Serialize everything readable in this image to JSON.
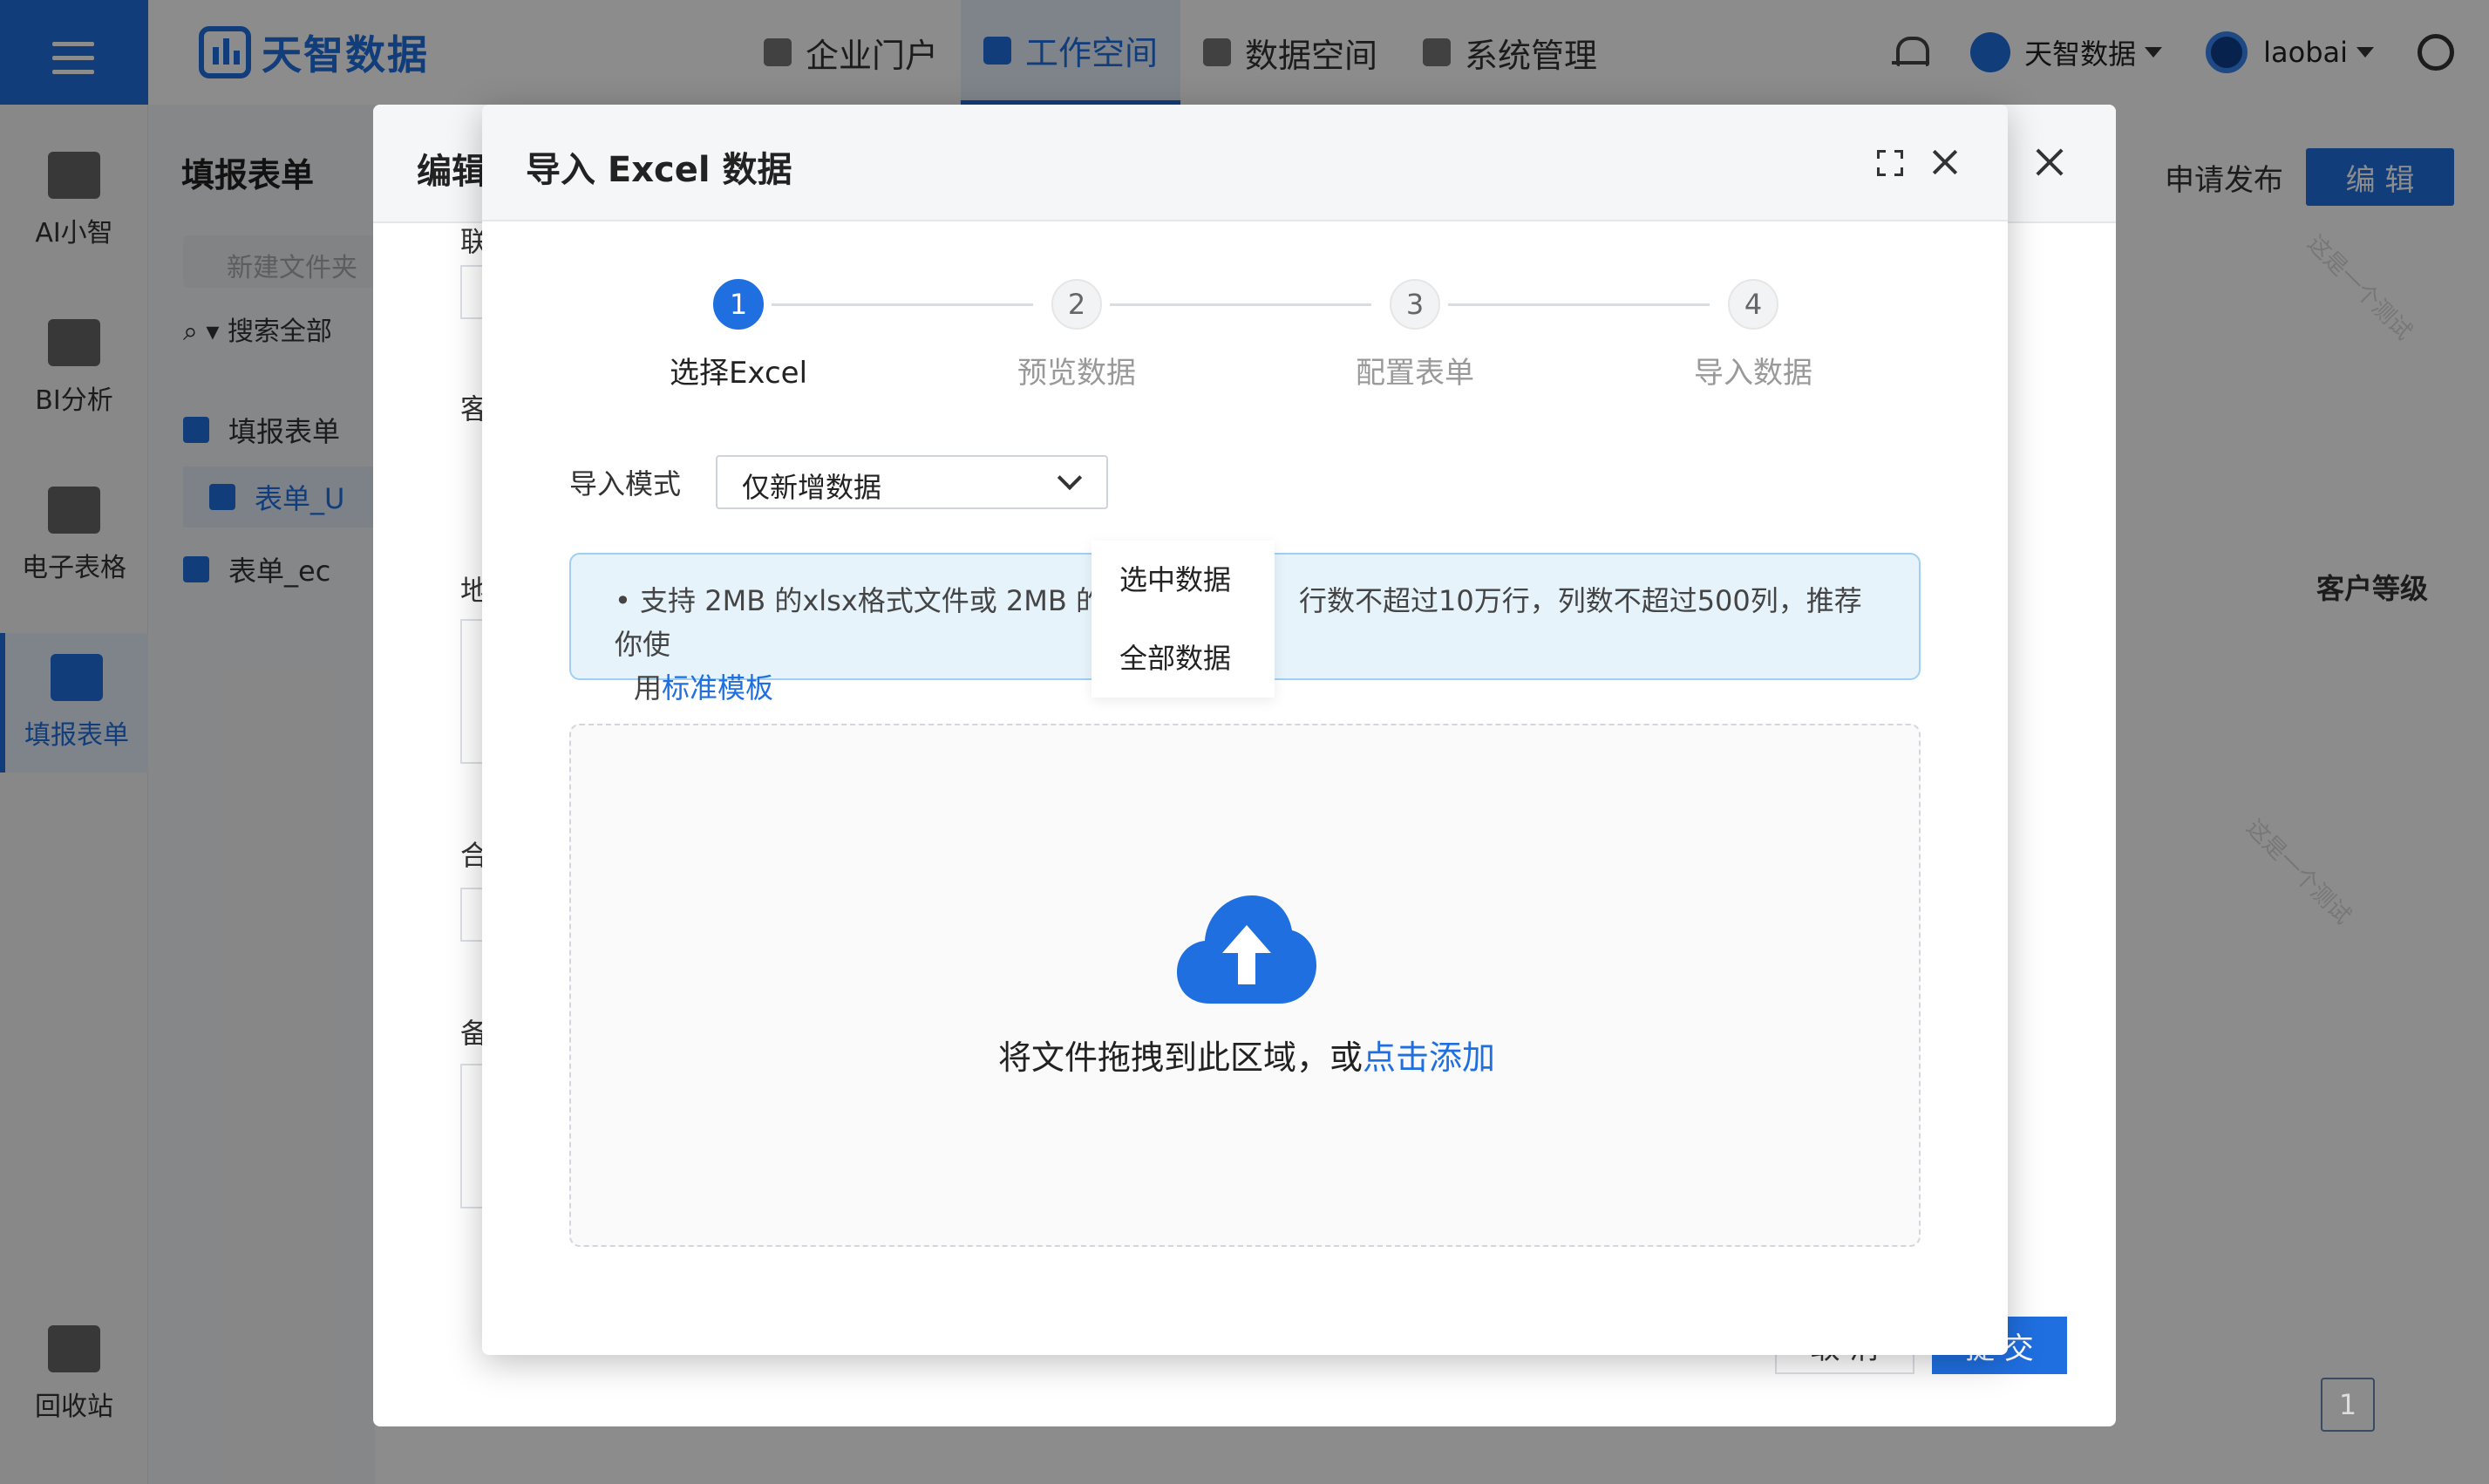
{
  "header": {
    "logo_text": "天智数据",
    "nav": [
      {
        "label": "企业门户",
        "active": false
      },
      {
        "label": "工作空间",
        "active": true
      },
      {
        "label": "数据空间",
        "active": false
      },
      {
        "label": "系统管理",
        "active": false
      }
    ],
    "org_name": "天智数据",
    "username": "laobai"
  },
  "sidebar": {
    "items": [
      {
        "label": "AI小智",
        "icon": "ai-icon",
        "active": false
      },
      {
        "label": "BI分析",
        "icon": "bi-chart-icon",
        "active": false
      },
      {
        "label": "电子表格",
        "icon": "spreadsheet-icon",
        "active": false
      },
      {
        "label": "填报表单",
        "icon": "form-icon",
        "active": true
      },
      {
        "label": "回收站",
        "icon": "trash-icon",
        "active": false
      }
    ]
  },
  "tree": {
    "title": "填报表单",
    "new_folder_placeholder": "新建文件夹",
    "search_label": "搜索全部",
    "root": "填报表单",
    "items": [
      "表单_U",
      "表单_ec"
    ]
  },
  "toolbar": {
    "publish_label": "申请发布",
    "edit_label": "编 辑",
    "column_header": "客户等级"
  },
  "drawer": {
    "title": "编辑",
    "field_labels": [
      "联",
      "客",
      "地",
      "合",
      "备"
    ],
    "cancel_label": "取 消",
    "submit_label": "提 交"
  },
  "modal": {
    "title": "导入 Excel 数据",
    "steps": [
      {
        "num": "1",
        "label": "选择Excel",
        "active": true
      },
      {
        "num": "2",
        "label": "预览数据",
        "active": false
      },
      {
        "num": "3",
        "label": "配置表单",
        "active": false
      },
      {
        "num": "4",
        "label": "导入数据",
        "active": false
      }
    ],
    "mode_label": "导入模式",
    "mode_value": "仅新增数据",
    "mode_options": [
      "选中数据",
      "全部数据"
    ],
    "info_bullet": "•",
    "info_line1_a": "支持 2MB 的xlsx格式文件或 2MB 的x",
    "info_line1_b": "行数不超过10万行，列数不超过500列，推荐你使",
    "info_line2_prefix": "用",
    "info_link": "标准模板",
    "upload_text": "将文件拖拽到此区域，或",
    "upload_link": "点击添加"
  },
  "pagination": {
    "page": "1"
  },
  "watermark_text": "这是一个测试",
  "colors": {
    "primary": "#1f6fe0",
    "info_bg": "#e7f3fb",
    "info_border": "#9fd0f2"
  }
}
